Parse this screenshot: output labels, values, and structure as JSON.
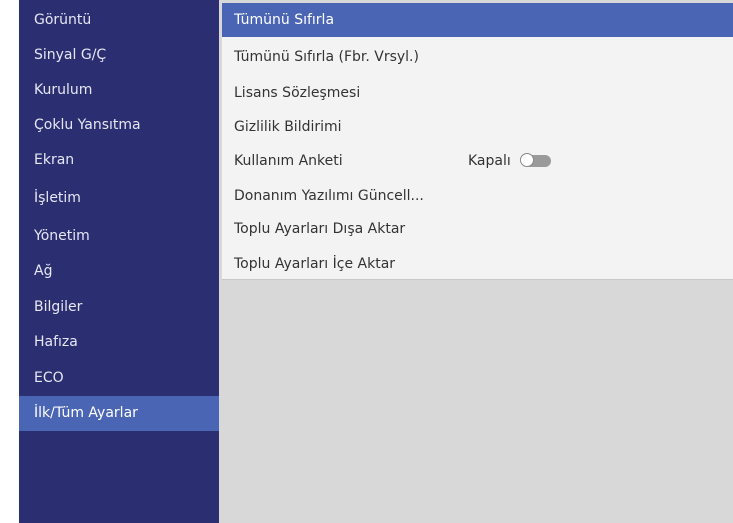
{
  "sidebar": {
    "items": [
      {
        "label": "Görüntü"
      },
      {
        "label": "Sinyal G/Ç"
      },
      {
        "label": "Kurulum"
      },
      {
        "label": "Çoklu Yansıtma"
      },
      {
        "label": "Ekran"
      },
      {
        "label": "İşletim"
      },
      {
        "label": "Yönetim"
      },
      {
        "label": "Ağ"
      },
      {
        "label": "Bilgiler"
      },
      {
        "label": "Hafıza"
      },
      {
        "label": "ECO"
      },
      {
        "label": "İlk/Tüm Ayarlar"
      }
    ],
    "selected_index": 11
  },
  "panel": {
    "items": [
      {
        "label": "Tümünü Sıfırla"
      },
      {
        "label": "Tümünü Sıfırla (Fbr. Vrsyl.)"
      },
      {
        "label": "Lisans Sözleşmesi"
      },
      {
        "label": "Gizlilik Bildirimi"
      },
      {
        "label": "Kullanım Anketi",
        "value": "Kapalı",
        "toggle": "off"
      },
      {
        "label": "Donanım Yazılımı Güncell..."
      },
      {
        "label": "Toplu Ayarları Dışa Aktar"
      },
      {
        "label": "Toplu Ayarları İçe Aktar"
      }
    ],
    "selected_index": 0
  },
  "colors": {
    "sidebar_bg": "#2b2f72",
    "accent": "#4a65b4",
    "panel_bg": "#d8d8d8",
    "list_bg": "#f3f3f3"
  }
}
